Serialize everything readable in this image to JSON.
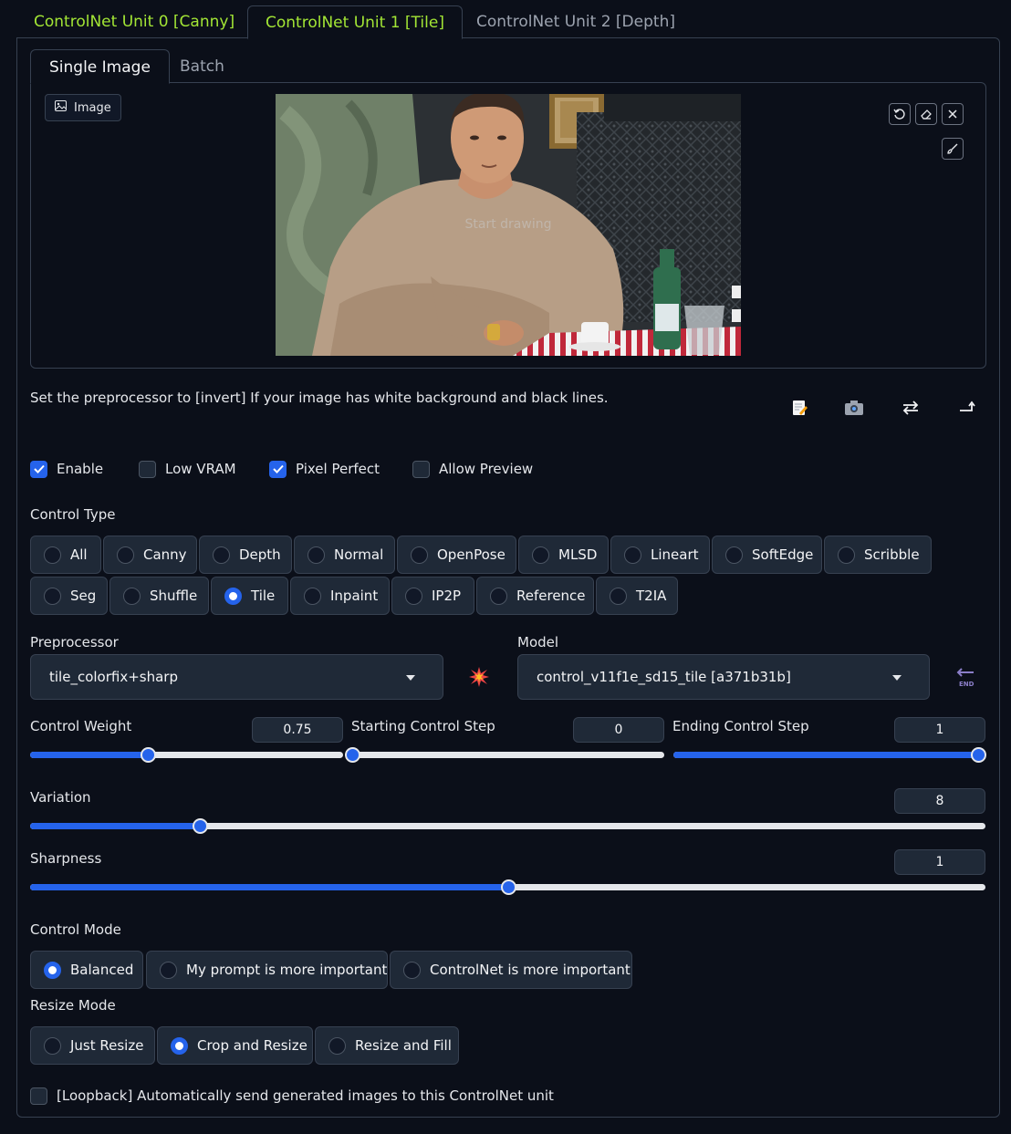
{
  "unit_tabs": [
    "ControlNet Unit 0 [Canny]",
    "ControlNet Unit 1 [Tile]",
    "ControlNet Unit 2 [Depth]"
  ],
  "input_tabs": [
    "Single Image",
    "Batch"
  ],
  "image_label": "Image",
  "canvas_hint": "Start drawing",
  "hint_text": "Set the preprocessor to [invert] If your image has white background and black lines.",
  "checkboxes": {
    "enable": "Enable",
    "low_vram": "Low VRAM",
    "pixel_perfect": "Pixel Perfect",
    "allow_preview": "Allow Preview"
  },
  "control_type": {
    "label": "Control Type",
    "options": [
      "All",
      "Canny",
      "Depth",
      "Normal",
      "OpenPose",
      "MLSD",
      "Lineart",
      "SoftEdge",
      "Scribble",
      "Seg",
      "Shuffle",
      "Tile",
      "Inpaint",
      "IP2P",
      "Reference",
      "T2IA"
    ],
    "selected": "Tile"
  },
  "preprocessor": {
    "label": "Preprocessor",
    "value": "tile_colorfix+sharp"
  },
  "model": {
    "label": "Model",
    "value": "control_v11f1e_sd15_tile [a371b31b]"
  },
  "sliders": {
    "control_weight": {
      "label": "Control Weight",
      "value": "0.75",
      "fraction": 0.375
    },
    "starting_step": {
      "label": "Starting Control Step",
      "value": "0",
      "fraction": 0.0
    },
    "ending_step": {
      "label": "Ending Control Step",
      "value": "1",
      "fraction": 1.0
    },
    "variation": {
      "label": "Variation",
      "value": "8",
      "fraction": 0.178
    },
    "sharpness": {
      "label": "Sharpness",
      "value": "1",
      "fraction": 0.5
    }
  },
  "control_mode": {
    "label": "Control Mode",
    "options": [
      "Balanced",
      "My prompt is more important",
      "ControlNet is more important"
    ],
    "selected": "Balanced"
  },
  "resize_mode": {
    "label": "Resize Mode",
    "options": [
      "Just Resize",
      "Crop and Resize",
      "Resize and Fill"
    ],
    "selected": "Crop and Resize"
  },
  "loopback": "[Loopback] Automatically send generated images to this ControlNet unit",
  "colors": {
    "accent": "#2563eb",
    "tab_green": "#a3e635",
    "bg": "#0b0f19",
    "panel": "#1f2937"
  }
}
